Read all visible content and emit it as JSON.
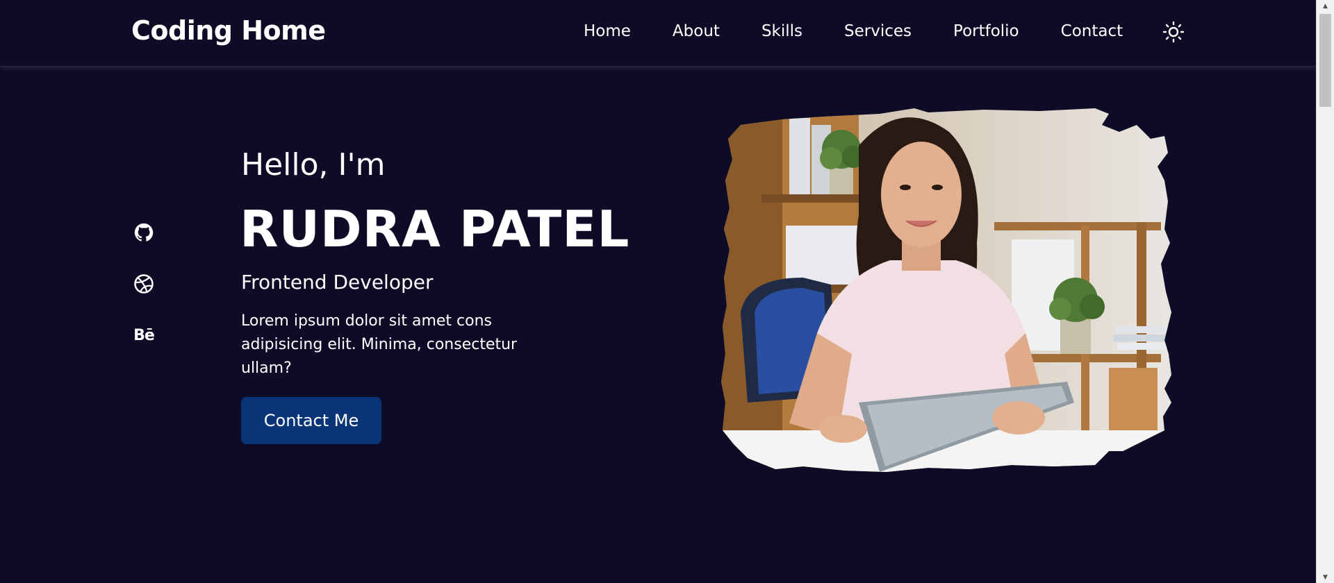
{
  "header": {
    "logo": "Coding Home",
    "nav": [
      "Home",
      "About",
      "Skills",
      "Services",
      "Portfolio",
      "Contact"
    ],
    "theme_toggle_icon": "sun-icon"
  },
  "socials": [
    {
      "name": "github",
      "icon": "github-icon"
    },
    {
      "name": "dribbble",
      "icon": "dribbble-icon"
    },
    {
      "name": "behance",
      "icon": "behance-icon",
      "text": "Bē"
    }
  ],
  "hero": {
    "greeting": "Hello, I'm",
    "name": "RUDRA PATEL",
    "role": "Frontend Developer",
    "description": "Lorem ipsum dolor sit amet cons adipisicing elit. Minima, consectetur ullam?",
    "cta_label": "Contact Me"
  },
  "colors": {
    "background": "#0e0b26",
    "button": "#0a3478",
    "text": "#ffffff"
  }
}
